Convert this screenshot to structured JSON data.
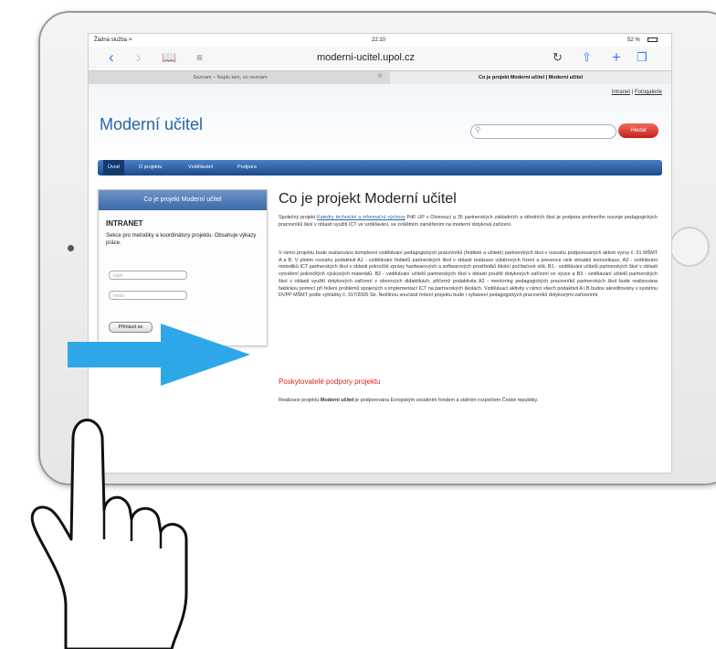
{
  "status_bar": {
    "carrier": "Žádná služba",
    "time": "22:10",
    "battery": "52 %"
  },
  "browser": {
    "url": "moderni-ucitel.upol.cz",
    "tabs": [
      {
        "label": "Seznam – Najdu tam, co neznám"
      },
      {
        "label": "Co je projekt Moderní učitel | Moderní učitel"
      }
    ]
  },
  "site": {
    "top_links": [
      "Intranet",
      "Fotogalerie"
    ],
    "top_links_separator": "|",
    "logo": "Moderní učitel",
    "search_placeholder": "",
    "search_button": "Hledat",
    "nav": [
      "Úvod",
      "O projektu",
      "Vzdělávání",
      "Podpora"
    ]
  },
  "sidebar": {
    "header": "Co je projekt Moderní učitel",
    "title": "INTRANET",
    "description": "Sekce pro metodiky a koordinátory projektu. Obsahuje výkazy práce.",
    "login_placeholder": "login",
    "password_placeholder": "heslo",
    "login_button": "Přihlásit se"
  },
  "main": {
    "title": "Co je projekt Moderní učitel",
    "p1_before": "Společný projekt ",
    "p1_link": "Katedry technické a informační výchovy",
    "p1_after": " PdF UP v Olomouci a 35 partnerských základních a středních škol je podpora profesního rozvoje pedagogických pracovníků škol v oblasti využití ICT ve vzdělávání, se zvláštním zaměřením na moderní dotyková zařízení.",
    "p2": "V rámci projektu bude realizováno komplexní vzdělávání pedagogických pracovníků (ředitelé a učitelé) partnerských škol v rozsahu podporovaných aktivit výzvy č. 51 MŠMT A a B. V plném rozsahu podaktivit A1 - vzdělávání ředitelů partnerských škol v oblasti realizace výběrových řízení a prevence rizik virtuální komunikace, A3 - vzdělávání metodiků ICT partnerských škol v oblasti pokročilé zprávy hardwarových a softwarových prostředků školní počítačové sítě, B1 - vzdělávání učitelů partnerských škol v oblasti vytváření pokročilých výukových materiálů, B2 - vzdělávání učitelů partnerských škol v oblasti použití dotykových zařízení ve výuce a B3 - vzdělávání učitelů partnerských škol v oblasti využití dotykových zařízení v oborových didaktikách, přičemž podaktivita A2 - mentoring pedagogických pracovníků partnerských škol bude realizována faktickou pomocí při řešení problémů spojených s implementací ICT na partnerských školách. Vzdělávací aktivity v rámci všech podaktivit A i B budou akreditovány v systému DVPP MŠMT podle vyhlášky č. 317/2005 Sb. Nedílnou součástí řešení projektu bude i vybavení pedagogických pracovníků dotykovými zařízeními.",
    "h2": "Poskytovatelé podpory projektu",
    "p3_before": "Realizace projektu ",
    "p3_bold": "Moderní učitel",
    "p3_after": " je podporována Evropským sociálním fondem a státním rozpočtem České republiky."
  },
  "colors": {
    "brand_blue": "#2a63a8",
    "nav_blue": "#1c4a8a",
    "search_red": "#c4221a",
    "arrow_blue": "#2ea7e8",
    "heading_red": "#dd2222"
  }
}
